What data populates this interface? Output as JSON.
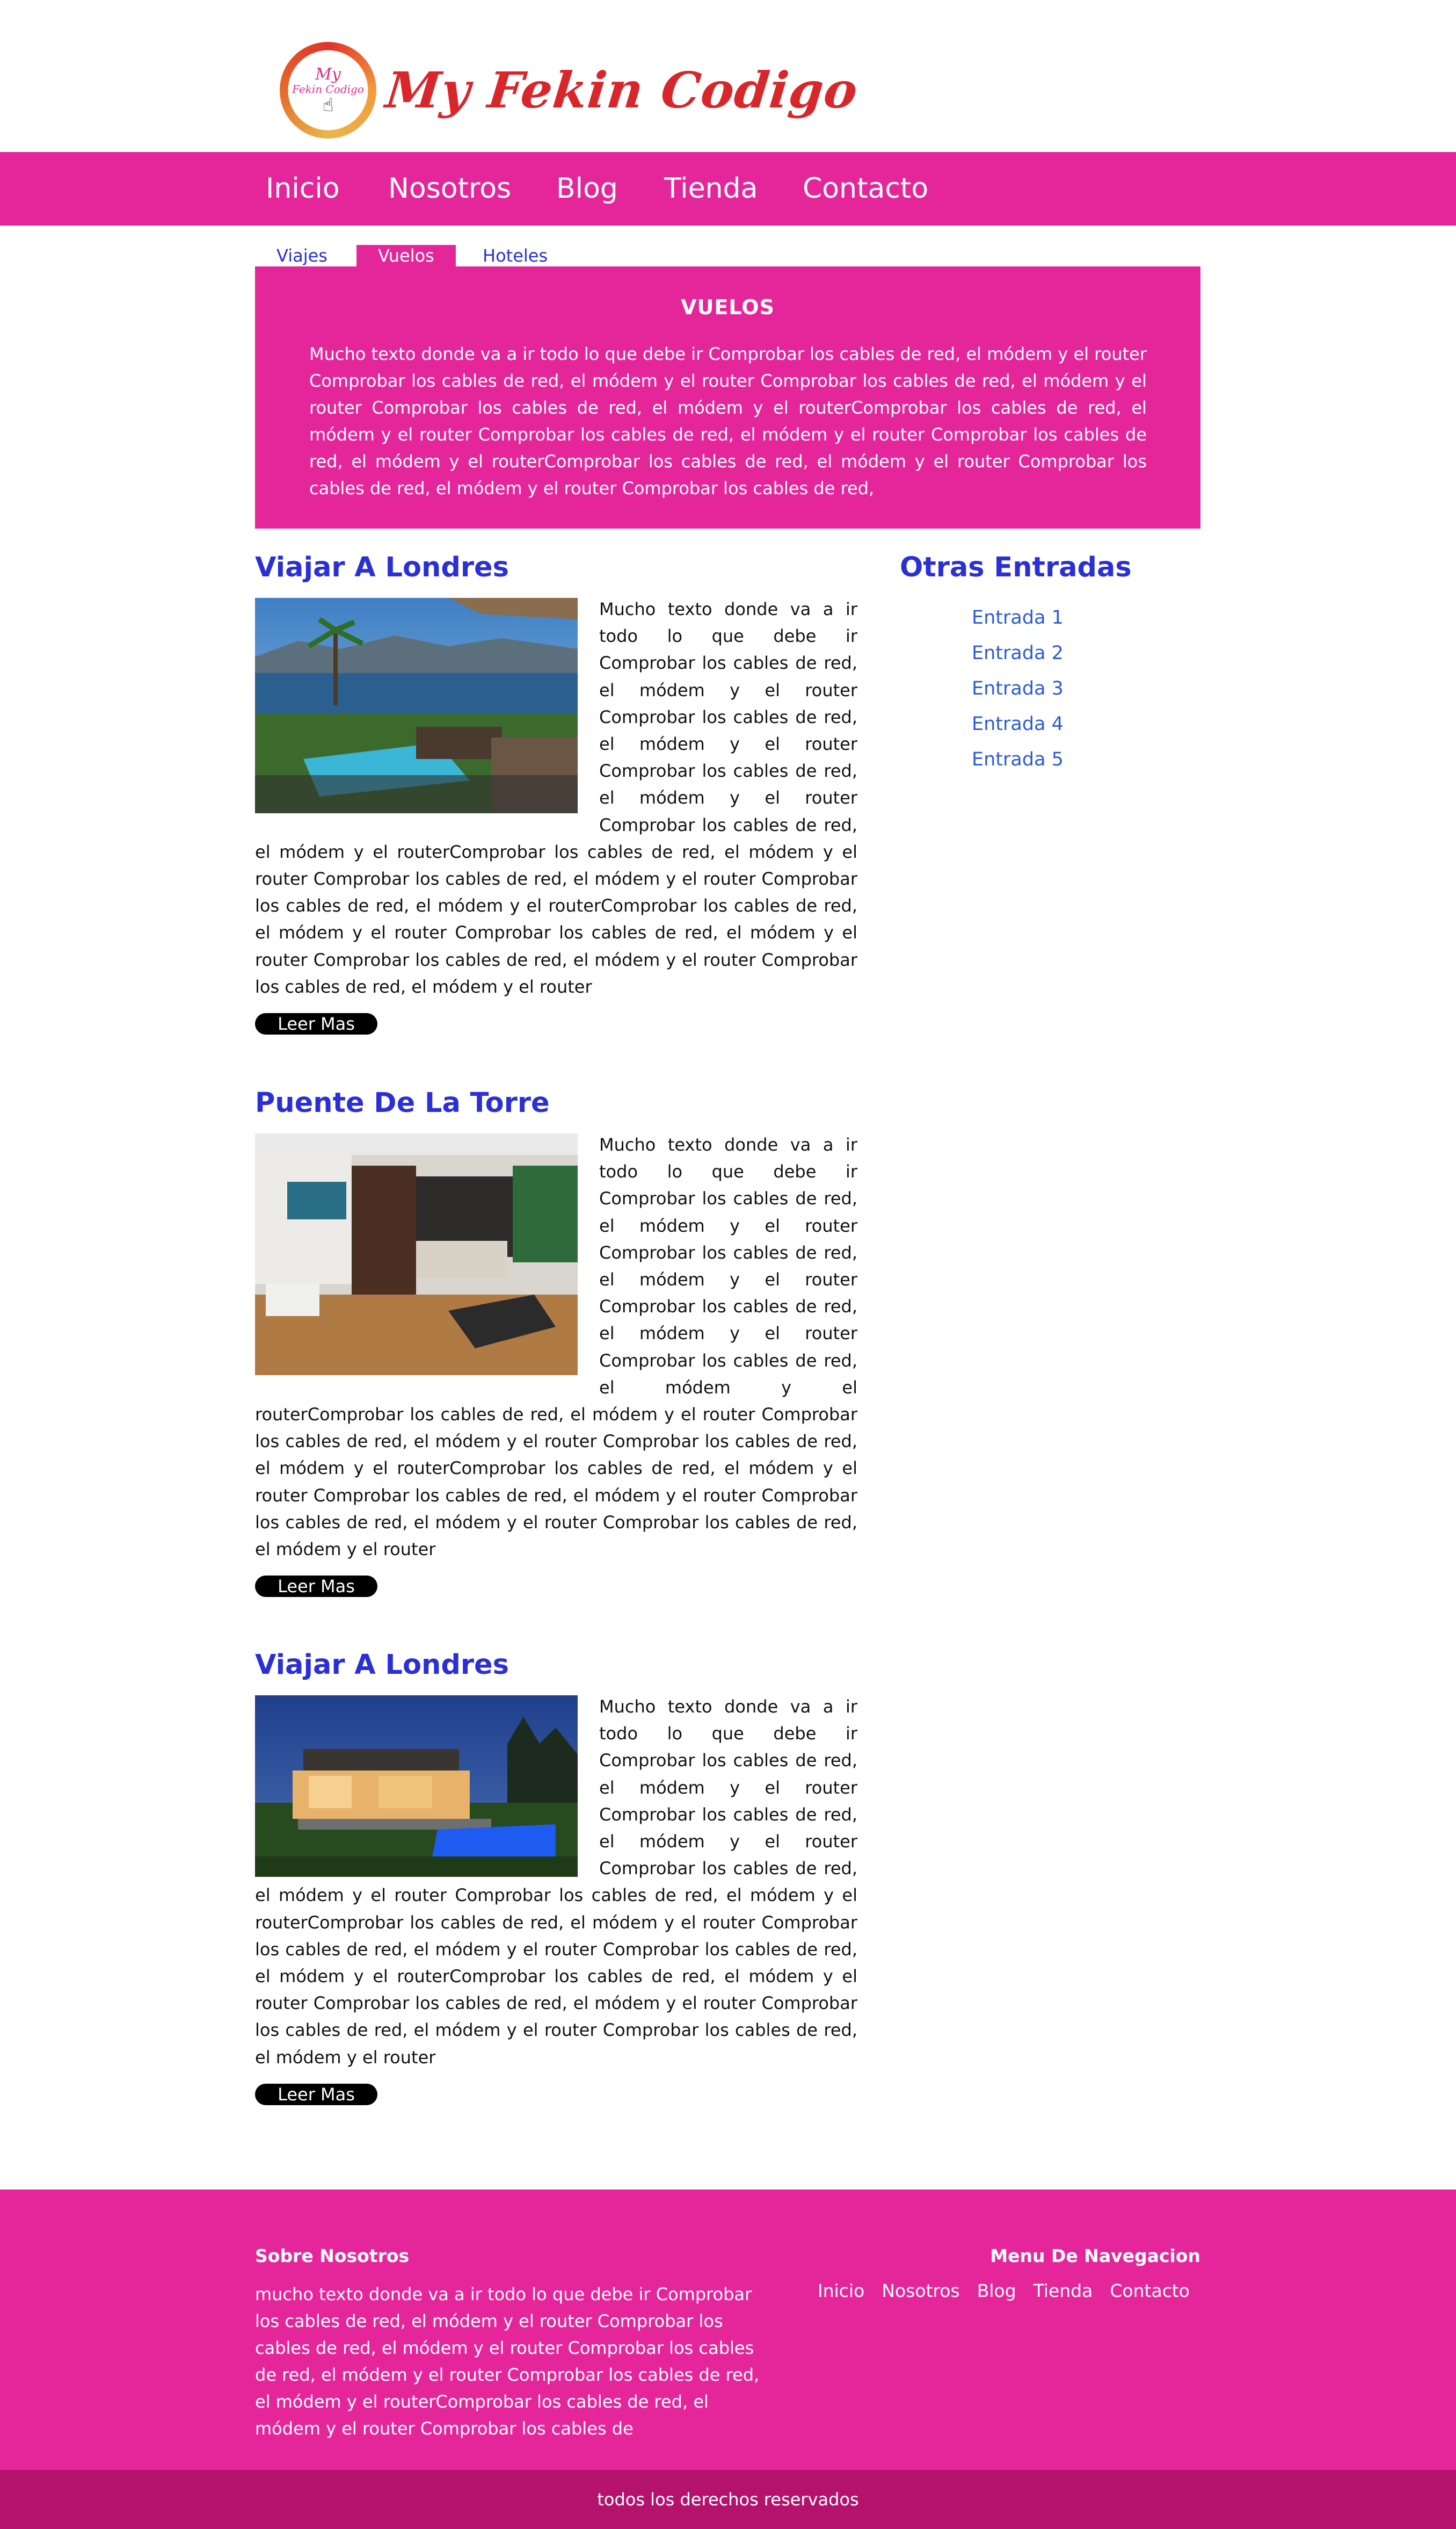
{
  "brand": {
    "badge_line1": "My",
    "badge_line2": "Fekin Codigo",
    "title": "My Fekin Codigo"
  },
  "nav": {
    "items": [
      {
        "label": "Inicio"
      },
      {
        "label": "Nosotros"
      },
      {
        "label": "Blog"
      },
      {
        "label": "Tienda"
      },
      {
        "label": "Contacto"
      }
    ]
  },
  "tabs": {
    "items": [
      {
        "label": "Viajes",
        "active": false
      },
      {
        "label": "Vuelos",
        "active": true
      },
      {
        "label": "Hoteles",
        "active": false
      }
    ]
  },
  "banner": {
    "title": "VUELOS",
    "text": "Mucho texto donde va a ir todo lo que debe ir Comprobar los cables de red, el módem y el router Comprobar los cables de red, el módem y el router Comprobar los cables de red, el módem y el router Comprobar los cables de red, el módem y el routerComprobar los cables de red, el módem y el router Comprobar los cables de red, el módem y el router Comprobar los cables de red, el módem y el routerComprobar los cables de red, el módem y el router Comprobar los cables de red, el módem y el router Comprobar los cables de red,"
  },
  "articles": [
    {
      "title": "Viajar A Londres",
      "image": "resort-pool-lake-image",
      "text": "Mucho texto donde va a ir todo lo que debe ir Comprobar los cables de red, el módem y el router Comprobar los cables de red, el módem y el router Comprobar los cables de red, el módem y el router Comprobar los cables de red, el módem y el routerComprobar los cables de red, el módem y el router Comprobar los cables de red, el módem y el router Comprobar los cables de red, el módem y el routerComprobar los cables de red, el módem y el router Comprobar los cables de red, el módem y el router Comprobar los cables de red, el módem y el router Comprobar los cables de red, el módem y el router",
      "button": "Leer Mas"
    },
    {
      "title": "Puente De La Torre",
      "image": "modern-interior-image",
      "text": "Mucho texto donde va a ir todo lo que debe ir Comprobar los cables de red, el módem y el router Comprobar los cables de red, el módem y el router Comprobar los cables de red, el módem y el router Comprobar los cables de red, el módem y el routerComprobar los cables de red, el módem y el router Comprobar los cables de red, el módem y el router Comprobar los cables de red, el módem y el routerComprobar los cables de red, el módem y el router Comprobar los cables de red, el módem y el router Comprobar los cables de red, el módem y el router Comprobar los cables de red, el módem y el router",
      "button": "Leer Mas"
    },
    {
      "title": "Viajar A Londres",
      "image": "night-house-pool-image",
      "text": "Mucho texto donde va a ir todo lo que debe ir Comprobar los cables de red, el módem y el router Comprobar los cables de red, el módem y el router Comprobar los cables de red, el módem y el router Comprobar los cables de red, el módem y el routerComprobar los cables de red, el módem y el router Comprobar los cables de red, el módem y el router Comprobar los cables de red, el módem y el routerComprobar los cables de red, el módem y el router Comprobar los cables de red, el módem y el router Comprobar los cables de red, el módem y el router Comprobar los cables de red, el módem y el router",
      "button": "Leer Mas"
    }
  ],
  "sidebar": {
    "title": "Otras Entradas",
    "items": [
      {
        "label": "Entrada 1"
      },
      {
        "label": "Entrada 2"
      },
      {
        "label": "Entrada 3"
      },
      {
        "label": "Entrada 4"
      },
      {
        "label": "Entrada 5"
      }
    ]
  },
  "footer": {
    "about_title": "Sobre Nosotros",
    "about_text": "mucho texto donde va a ir todo lo que debe ir Comprobar los cables de red, el módem y el router Comprobar los cables de red, el módem y el router Comprobar los cables de red, el módem y el router Comprobar los cables de red, el módem y el routerComprobar los cables de red, el módem y el router Comprobar los cables de",
    "nav_title": "Menu De Navegacion",
    "nav_items": [
      {
        "label": "Inicio"
      },
      {
        "label": "Nosotros"
      },
      {
        "label": "Blog"
      },
      {
        "label": "Tienda"
      },
      {
        "label": "Contacto"
      }
    ],
    "copyright": "todos los derechos reservados"
  },
  "colors": {
    "primary": "#e5269b",
    "dark_primary": "#b5126d",
    "link_blue": "#2b2fd6",
    "logo_red": "#d9262b"
  }
}
